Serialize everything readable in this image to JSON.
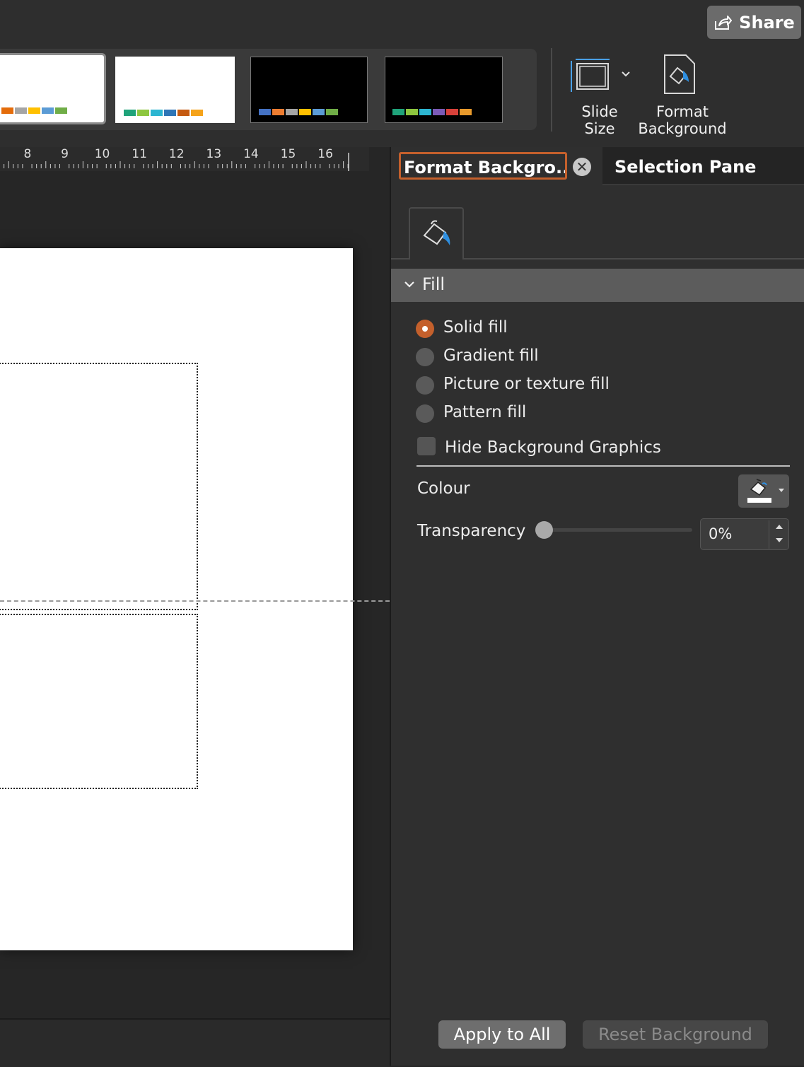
{
  "ribbon": {
    "share_label": "Share",
    "slide_size_label_line1": "Slide",
    "slide_size_label_line2": "Size",
    "format_bg_label_line1": "Format",
    "format_bg_label_line2": "Background",
    "themes": [
      {
        "bg": "#ffffff",
        "swatches": [
          "#e46c0a",
          "#a5a5a5",
          "#ffc000",
          "#5b9bd5",
          "#70ad47"
        ]
      },
      {
        "bg": "#ffffff",
        "swatches": [
          "#1fa37a",
          "#8dc63f",
          "#2cb5d1",
          "#2e75b6",
          "#c55a11",
          "#f5a31a"
        ]
      },
      {
        "bg": "#000000",
        "swatches": [
          "#4472c4",
          "#ed7d31",
          "#a5a5a5",
          "#ffc000",
          "#5b9bd5",
          "#70ad47"
        ]
      },
      {
        "bg": "#000000",
        "swatches": [
          "#1fa37a",
          "#8dc63f",
          "#2cb5d1",
          "#7b5ab7",
          "#d8413a",
          "#e89a2c"
        ]
      }
    ]
  },
  "ruler": {
    "numbers": [
      "8",
      "9",
      "10",
      "11",
      "12",
      "13",
      "14",
      "15",
      "16"
    ]
  },
  "pane": {
    "tab_format": "Format Backgro...",
    "tab_close": "✕",
    "tab_selection": "Selection Pane",
    "fill_header": "Fill",
    "fill_options": [
      "Solid fill",
      "Gradient fill",
      "Picture or texture fill",
      "Pattern fill"
    ],
    "selected_fill": "Solid fill",
    "hide_bg_label": "Hide Background Graphics",
    "colour_label": "Colour",
    "transparency_label": "Transparency",
    "transparency_value": "0%",
    "apply_all_label": "Apply to All",
    "reset_label": "Reset Background"
  },
  "colors": {
    "accent": "#c4602c"
  }
}
